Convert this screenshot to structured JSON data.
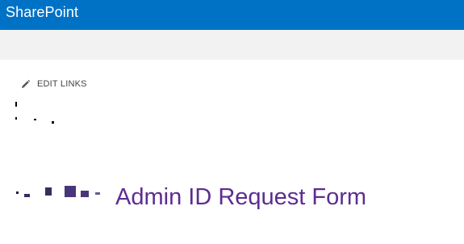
{
  "suite_bar": {
    "brand": "SharePoint",
    "background": "#0072c6"
  },
  "ribbon": {
    "background": "#f2f2f2"
  },
  "quick_launch": {
    "edit_links_label": "EDIT LINKS",
    "edit_icon": "pencil-icon"
  },
  "page": {
    "title": "Admin ID Request Form",
    "title_color": "#5c2d91"
  }
}
